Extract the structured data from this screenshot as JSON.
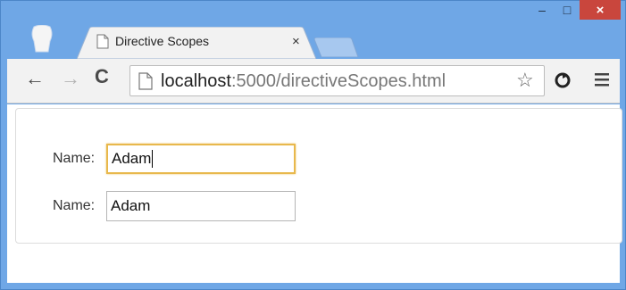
{
  "browser": {
    "tab": {
      "title": "Directive Scopes",
      "close": "×"
    },
    "controls": {
      "minimize": "–",
      "maximize": "□",
      "close": "×"
    },
    "toolbar": {
      "back": "←",
      "forward": "→",
      "reload": "C",
      "url_host": "localhost",
      "url_rest": ":5000/directiveScopes.html",
      "star": "☆"
    }
  },
  "page": {
    "fields": [
      {
        "label": "Name:",
        "value": "Adam",
        "focused": true
      },
      {
        "label": "Name:",
        "value": "Adam",
        "focused": false
      }
    ]
  },
  "colors": {
    "frame": "#6fa7e6",
    "close_button": "#c9463d",
    "focus_ring": "#e8b84c"
  }
}
